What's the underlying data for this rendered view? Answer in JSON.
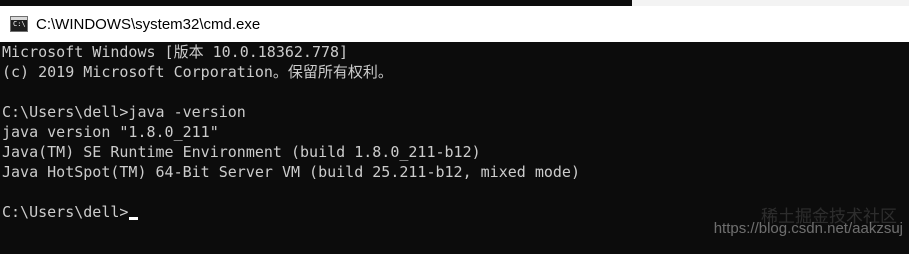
{
  "window": {
    "title": "C:\\WINDOWS\\system32\\cmd.exe",
    "icon": "cmd-icon"
  },
  "console": {
    "lines": [
      "Microsoft Windows [版本 10.0.18362.778]",
      "(c) 2019 Microsoft Corporation。保留所有权利。",
      "",
      "C:\\Users\\dell>java -version",
      "java version \"1.8.0_211\"",
      "Java(TM) SE Runtime Environment (build 1.8.0_211-b12)",
      "Java HotSpot(TM) 64-Bit Server VM (build 25.211-b12, mixed mode)",
      "",
      "C:\\Users\\dell>"
    ]
  },
  "watermark": {
    "site_name": "稀土掘金技术社区",
    "url": "https://blog.csdn.net/aakzsuj"
  },
  "colors": {
    "console_background": "#0c0c0c",
    "console_text": "#cccccc",
    "titlebar_background": "#ffffff"
  }
}
